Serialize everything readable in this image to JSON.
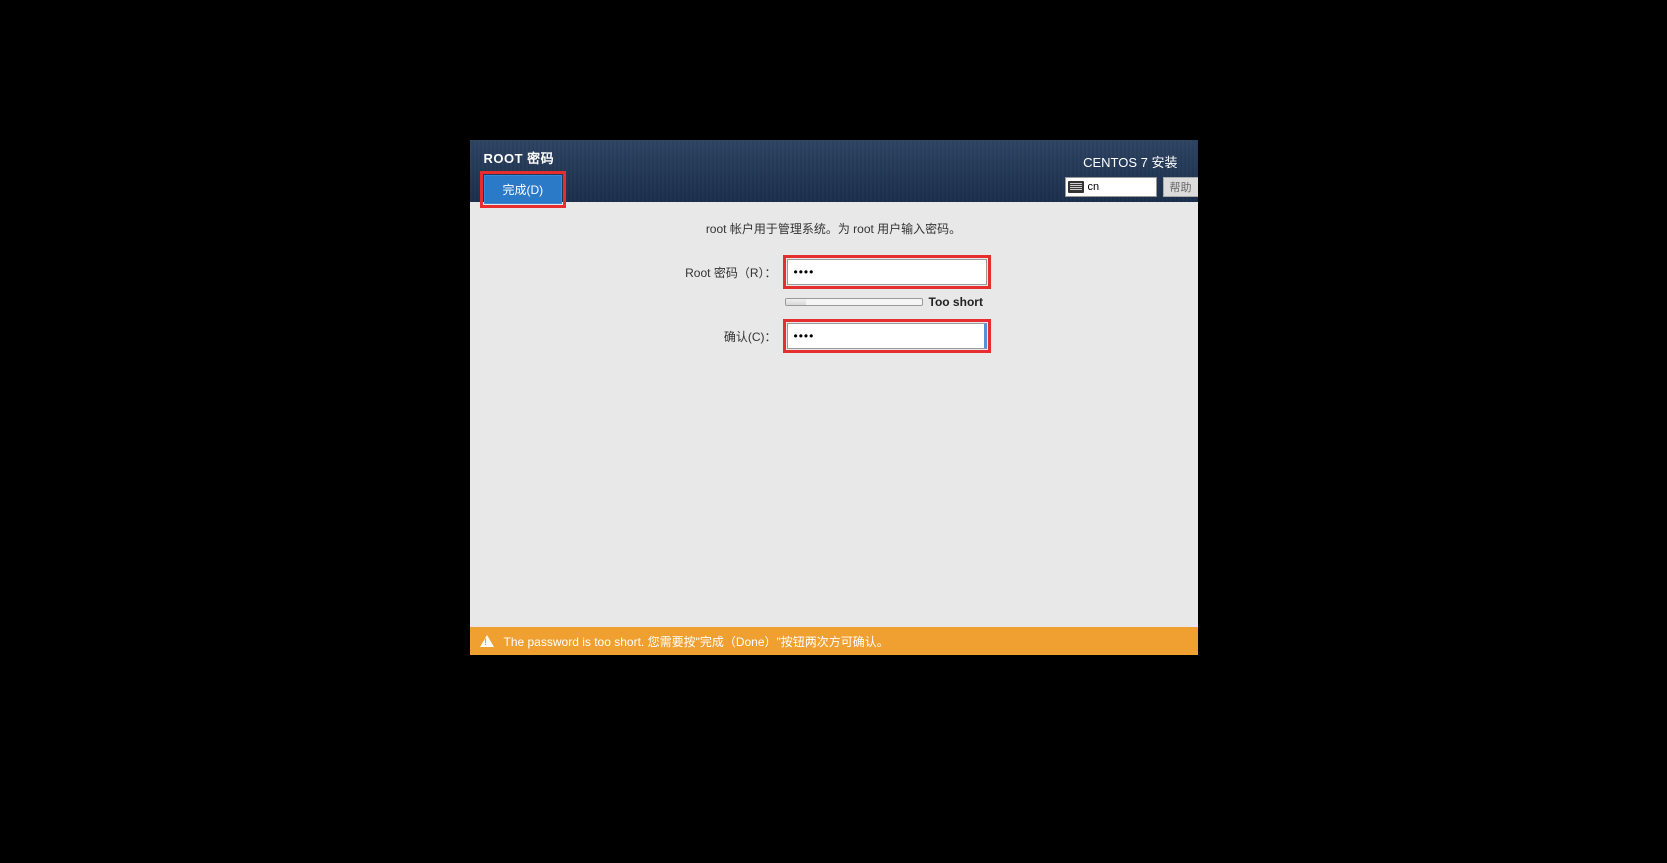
{
  "header": {
    "title": "ROOT 密码",
    "done_button": "完成(D)",
    "install_title": "CENTOS 7 安装",
    "keyboard_layout": "cn",
    "help_button": "帮助"
  },
  "content": {
    "description": "root 帐户用于管理系统。为 root 用户输入密码。",
    "root_password_label": "Root 密码（R）：",
    "root_password_value": "••••",
    "strength_text": "Too short",
    "confirm_label": "确认(C)：",
    "confirm_value": "••••"
  },
  "warning": {
    "message": "The password is too short. 您需要按\"完成（Done）\"按钮两次方可确认。"
  }
}
